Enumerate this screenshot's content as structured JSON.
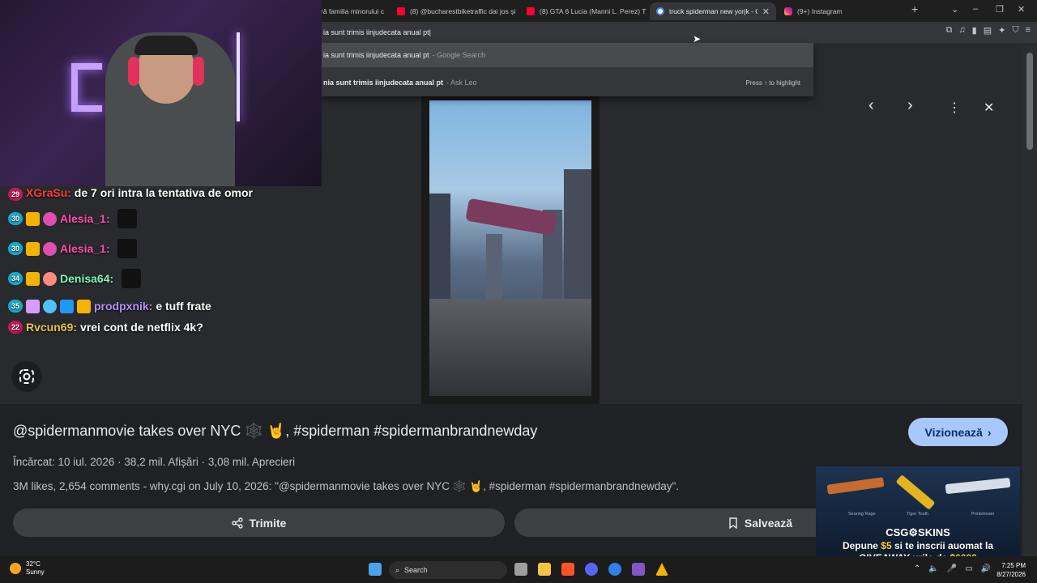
{
  "browser": {
    "tabs": [
      {
        "label": "ră familia minorului c",
        "favicon": "none"
      },
      {
        "label": "(8) @bucharestbiketraffic dai jos și",
        "favicon": "youtube"
      },
      {
        "label": "(8) GTA 6 Lucia (Manni L. Perez) TV",
        "favicon": "youtube"
      },
      {
        "label": "truck spiderman new yorjk - Căut",
        "favicon": "google",
        "active": true
      },
      {
        "label": "(9+) Instagram",
        "favicon": "instagram"
      }
    ],
    "new_tab": "+",
    "omnibox_text": "ia sunt trimis iinjudecata anual pt",
    "suggestions": [
      {
        "text": "ia sunt trimis iinjudecata anual pt",
        "source": "- Google Search"
      },
      {
        "text": "nia sunt trimis iinjudecata anual pt",
        "source": "- Ask Leo",
        "hint": "Press ↑ to highlight"
      }
    ]
  },
  "result": {
    "title": "@spidermanmovie takes over NYC 🕸️ 🤘, #spiderman #spidermanbrandnewday",
    "watch_button": "Vizionează",
    "meta": "Încărcat: 10 iul. 2026  ·  38,2 mil. Afișări  ·  3,08 mil. Aprecieri",
    "description": "3M likes, 2,654 comments - why.cgi on July 10, 2026: \"@spidermanmovie takes over NYC 🕸️ 🤘, #spiderman #spidermanbrandnewday\".",
    "share_button": "Trimite",
    "save_button": "Salvează"
  },
  "chat": [
    {
      "badge": "29",
      "badge_color": "#c2185b",
      "user": "XGraSu:",
      "user_color": "#ff3b3b",
      "text": "de 7 ori intra la tentativa de omor"
    },
    {
      "badge": "30",
      "badge_color": "#1aa8c9",
      "user": "Alesia_1:",
      "user_color": "#ff4fb0",
      "text": ""
    },
    {
      "badge": "30",
      "badge_color": "#1aa8c9",
      "user": "Alesia_1:",
      "user_color": "#ff4fb0",
      "text": ""
    },
    {
      "badge": "34",
      "badge_color": "#1aa8c9",
      "user": "Denisa64:",
      "user_color": "#7dffb0",
      "text": ""
    },
    {
      "badge": "35",
      "badge_color": "#1aa8c9",
      "user": "prodpxnik:",
      "user_color": "#b98cff",
      "text": "e tuff frate"
    },
    {
      "badge": "22",
      "badge_color": "#c2185b",
      "user": "Rvcun69:",
      "user_color": "#e6c24a",
      "text": "vrei cont de netflix 4k?"
    }
  ],
  "ad": {
    "items": [
      "Searing Rage",
      "Tiger Tooth",
      "Printstream"
    ],
    "brand": "CSG⚙SKINS",
    "line1_a": "Depune ",
    "line1_amount": "$5",
    "line1_b": " si te inscrii auomat la",
    "line2_a": "GIVEAWAY-urile de ",
    "line2_amount": "$6000"
  },
  "taskbar": {
    "temperature": "32°C",
    "condition": "Sunny",
    "search_label": "Search",
    "time": "7:25 PM",
    "date": "8/27/2026"
  },
  "colors": {
    "accent_button": "#a8c7fa",
    "page_bg": "#202124"
  }
}
